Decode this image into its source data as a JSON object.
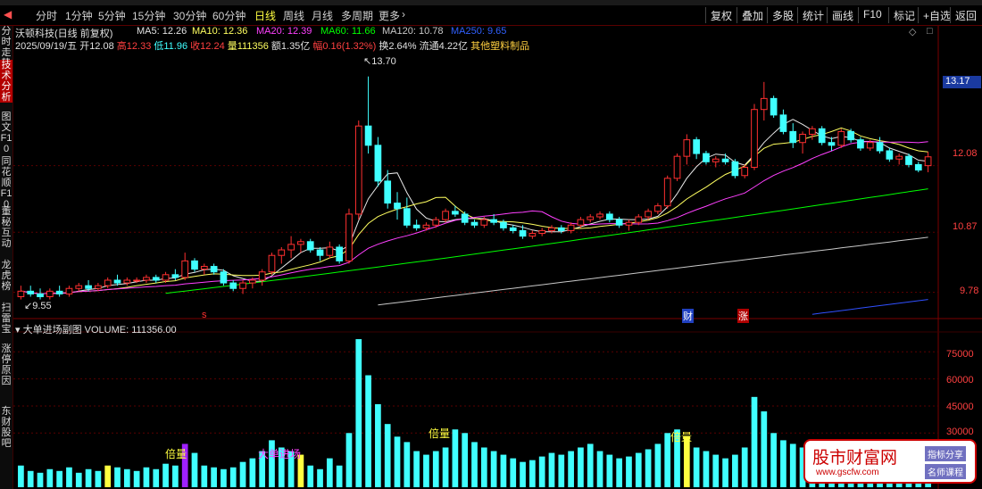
{
  "toolbar": {
    "back_icon": "back-arrow-icon",
    "periods": [
      "分时",
      "1分钟",
      "5分钟",
      "15分钟",
      "30分钟",
      "60分钟",
      "日线",
      "周线",
      "月线",
      "多周期",
      "更多"
    ],
    "active_period": "日线",
    "right_buttons": [
      "复权",
      "叠加",
      "多股",
      "统计",
      "画线",
      "F10",
      "标记",
      "+自选",
      "返回"
    ]
  },
  "sidebar": {
    "items": [
      "分时走势",
      "技术分析",
      "图文F10",
      "同花顺F10",
      "董秘互动",
      "龙虎榜",
      "扫雷宝",
      "涨停原因",
      "东财股吧"
    ],
    "selected": "技术分析"
  },
  "stock": {
    "title": "沃顿科技(日线 前复权)",
    "date": "2025/09/19/五",
    "open_label": "开",
    "open": "12.08",
    "high_label": "高",
    "high": "12.33",
    "low_label": "低",
    "low": "11.96",
    "close_label": "收",
    "close": "12.24",
    "vol_label": "量",
    "vol": "111356",
    "amount_label": "额",
    "amount": "1.35亿",
    "chg_label": "幅",
    "chg": "0.16(1.32%)",
    "turnover_label": "换",
    "turnover": "2.64%",
    "float_label": "流通",
    "float": "4.22亿",
    "sector": "其他塑料制品"
  },
  "ma": {
    "ma5": "MA5: 12.26",
    "ma10": "MA10: 12.36",
    "ma20": "MA20: 12.39",
    "ma60": "MA60: 11.66",
    "ma120": "MA120: 10.78",
    "ma250": "MA250: 9.65"
  },
  "colors": {
    "up": "#ff3030",
    "down": "#40ffff",
    "ma5": "#e8e8e8",
    "ma10": "#ffff60",
    "ma20": "#ff40ff",
    "ma60": "#00ff00",
    "ma120": "#c8c8c8",
    "ma250": "#3050ff",
    "vol_bar": "#40ffff",
    "vol_hl": "#ffff40",
    "vol_big": "#a020ff"
  },
  "price_axis": {
    "ticks": [
      "12.08",
      "10.87",
      "9.78"
    ],
    "current": "13.17"
  },
  "markers": {
    "high": "13.70",
    "low": "9.55",
    "s": "s",
    "cai": "财",
    "zhang": "涨"
  },
  "sub": {
    "title": "大单进场副图",
    "volume": "VOLUME: 111356.00",
    "ticks": [
      "75000",
      "60000",
      "45000",
      "30000"
    ],
    "labels": {
      "beiliang": "倍量",
      "dadan": "大单进场"
    }
  },
  "chart_data": {
    "type": "candlestick",
    "price_range": [
      9.4,
      14.1
    ],
    "volume_range": [
      0,
      85000
    ],
    "candles": [
      [
        9.7,
        9.9,
        9.65,
        9.8
      ],
      [
        9.8,
        9.9,
        9.7,
        9.75
      ],
      [
        9.75,
        9.85,
        9.65,
        9.7
      ],
      [
        9.7,
        9.85,
        9.65,
        9.8
      ],
      [
        9.8,
        9.9,
        9.7,
        9.75
      ],
      [
        9.75,
        9.9,
        9.7,
        9.85
      ],
      [
        9.85,
        9.95,
        9.8,
        9.9
      ],
      [
        9.9,
        10.0,
        9.8,
        9.85
      ],
      [
        9.85,
        9.95,
        9.8,
        9.9
      ],
      [
        9.9,
        10.05,
        9.85,
        10.0
      ],
      [
        10.0,
        10.1,
        9.9,
        9.95
      ],
      [
        9.95,
        10.05,
        9.9,
        10.0
      ],
      [
        10.0,
        10.05,
        9.95,
        10.0
      ],
      [
        10.0,
        10.1,
        9.95,
        10.05
      ],
      [
        10.05,
        10.1,
        9.95,
        10.0
      ],
      [
        10.0,
        10.15,
        9.95,
        10.1
      ],
      [
        10.1,
        10.2,
        10.0,
        10.05
      ],
      [
        10.05,
        10.5,
        10.0,
        10.35
      ],
      [
        10.35,
        10.4,
        10.15,
        10.2
      ],
      [
        10.2,
        10.3,
        10.1,
        10.25
      ],
      [
        10.25,
        10.3,
        10.1,
        10.15
      ],
      [
        10.15,
        10.2,
        9.9,
        9.95
      ],
      [
        9.95,
        10.0,
        9.8,
        9.85
      ],
      [
        9.85,
        10.0,
        9.75,
        9.95
      ],
      [
        9.95,
        10.05,
        9.85,
        10.0
      ],
      [
        10.0,
        10.2,
        9.9,
        10.15
      ],
      [
        10.15,
        10.5,
        10.1,
        10.45
      ],
      [
        10.45,
        10.6,
        10.3,
        10.55
      ],
      [
        10.55,
        10.8,
        10.4,
        10.65
      ],
      [
        10.65,
        10.75,
        10.5,
        10.7
      ],
      [
        10.7,
        10.75,
        10.5,
        10.55
      ],
      [
        10.55,
        10.6,
        10.35,
        10.45
      ],
      [
        10.45,
        10.7,
        10.4,
        10.6
      ],
      [
        10.6,
        10.65,
        10.3,
        10.35
      ],
      [
        10.35,
        11.3,
        10.3,
        11.2
      ],
      [
        11.2,
        12.9,
        11.1,
        12.8
      ],
      [
        12.8,
        13.7,
        12.3,
        12.45
      ],
      [
        12.45,
        12.6,
        11.7,
        11.8
      ],
      [
        11.8,
        12.0,
        11.3,
        11.4
      ],
      [
        11.4,
        11.6,
        11.1,
        11.3
      ],
      [
        11.3,
        11.5,
        10.95,
        11.0
      ],
      [
        11.0,
        11.1,
        10.9,
        10.95
      ],
      [
        10.95,
        11.05,
        10.9,
        11.0
      ],
      [
        11.0,
        11.15,
        10.95,
        11.1
      ],
      [
        11.1,
        11.3,
        11.05,
        11.25
      ],
      [
        11.25,
        11.35,
        11.15,
        11.2
      ],
      [
        11.2,
        11.25,
        11.0,
        11.05
      ],
      [
        11.05,
        11.1,
        10.95,
        11.0
      ],
      [
        11.0,
        11.15,
        10.95,
        11.1
      ],
      [
        11.1,
        11.2,
        11.0,
        11.05
      ],
      [
        11.05,
        11.1,
        10.9,
        10.95
      ],
      [
        10.95,
        11.0,
        10.85,
        10.9
      ],
      [
        10.9,
        11.0,
        10.75,
        10.8
      ],
      [
        10.8,
        10.9,
        10.75,
        10.85
      ],
      [
        10.85,
        10.95,
        10.8,
        10.9
      ],
      [
        10.9,
        11.0,
        10.85,
        10.95
      ],
      [
        10.95,
        11.0,
        10.85,
        10.9
      ],
      [
        10.9,
        11.05,
        10.85,
        11.0
      ],
      [
        11.0,
        11.15,
        10.95,
        11.1
      ],
      [
        11.1,
        11.2,
        11.05,
        11.15
      ],
      [
        11.15,
        11.25,
        11.1,
        11.2
      ],
      [
        11.2,
        11.25,
        11.05,
        11.1
      ],
      [
        11.1,
        11.15,
        10.95,
        11.0
      ],
      [
        11.0,
        11.1,
        10.9,
        11.05
      ],
      [
        11.05,
        11.2,
        11.0,
        11.15
      ],
      [
        11.15,
        11.3,
        11.1,
        11.25
      ],
      [
        11.25,
        11.4,
        11.2,
        11.35
      ],
      [
        11.35,
        11.9,
        11.3,
        11.85
      ],
      [
        11.85,
        12.3,
        11.8,
        12.25
      ],
      [
        12.25,
        12.65,
        12.1,
        12.55
      ],
      [
        12.55,
        12.6,
        12.2,
        12.3
      ],
      [
        12.3,
        12.35,
        12.1,
        12.15
      ],
      [
        12.15,
        12.25,
        12.05,
        12.2
      ],
      [
        12.2,
        12.3,
        12.1,
        12.15
      ],
      [
        12.15,
        12.2,
        11.85,
        11.9
      ],
      [
        11.9,
        12.1,
        11.85,
        12.05
      ],
      [
        12.05,
        13.2,
        12.0,
        13.1
      ],
      [
        13.1,
        13.6,
        12.9,
        13.3
      ],
      [
        13.3,
        13.35,
        12.95,
        13.0
      ],
      [
        13.0,
        13.1,
        12.65,
        12.7
      ],
      [
        12.7,
        12.85,
        12.4,
        12.5
      ],
      [
        12.5,
        12.7,
        12.3,
        12.65
      ],
      [
        12.65,
        12.8,
        12.55,
        12.75
      ],
      [
        12.75,
        12.8,
        12.45,
        12.5
      ],
      [
        12.5,
        12.6,
        12.35,
        12.45
      ],
      [
        12.45,
        12.75,
        12.4,
        12.7
      ],
      [
        12.7,
        12.75,
        12.5,
        12.55
      ],
      [
        12.55,
        12.6,
        12.35,
        12.4
      ],
      [
        12.4,
        12.55,
        12.35,
        12.5
      ],
      [
        12.5,
        12.6,
        12.3,
        12.35
      ],
      [
        12.35,
        12.4,
        12.15,
        12.2
      ],
      [
        12.2,
        12.3,
        12.1,
        12.25
      ],
      [
        12.25,
        12.3,
        12.05,
        12.1
      ],
      [
        12.1,
        12.15,
        11.96,
        12.0
      ],
      [
        12.08,
        12.33,
        11.96,
        12.24
      ]
    ],
    "volumes": [
      12000,
      9000,
      8000,
      10000,
      9000,
      11000,
      8000,
      10000,
      9000,
      12000,
      11000,
      10000,
      9000,
      11000,
      10000,
      13000,
      12000,
      24000,
      19000,
      12000,
      11000,
      10000,
      11000,
      14000,
      16000,
      20000,
      26000,
      22000,
      20000,
      18000,
      12000,
      10000,
      16000,
      12000,
      30000,
      82000,
      62000,
      46000,
      35000,
      28000,
      25000,
      20000,
      18000,
      20000,
      22000,
      32000,
      30000,
      25000,
      22000,
      20000,
      18000,
      16000,
      14000,
      15000,
      17000,
      19000,
      18000,
      20000,
      22000,
      24000,
      20000,
      18000,
      16000,
      17000,
      19000,
      21000,
      24000,
      30000,
      32000,
      28000,
      22000,
      20000,
      18000,
      16000,
      18000,
      22000,
      50000,
      42000,
      30000,
      26000,
      24000,
      22000,
      20000,
      18000,
      17000,
      16000,
      18000,
      16000,
      15000,
      14000,
      13000,
      12000,
      11000,
      10000,
      11000
    ],
    "highlight_bars": {
      "beiliang": [
        9,
        29,
        69
      ],
      "dadan": [
        17
      ]
    }
  },
  "watermark": {
    "title": "股市财富网",
    "url": "www.gscfw.com",
    "tag1": "指标分享",
    "tag2": "名师课程"
  }
}
